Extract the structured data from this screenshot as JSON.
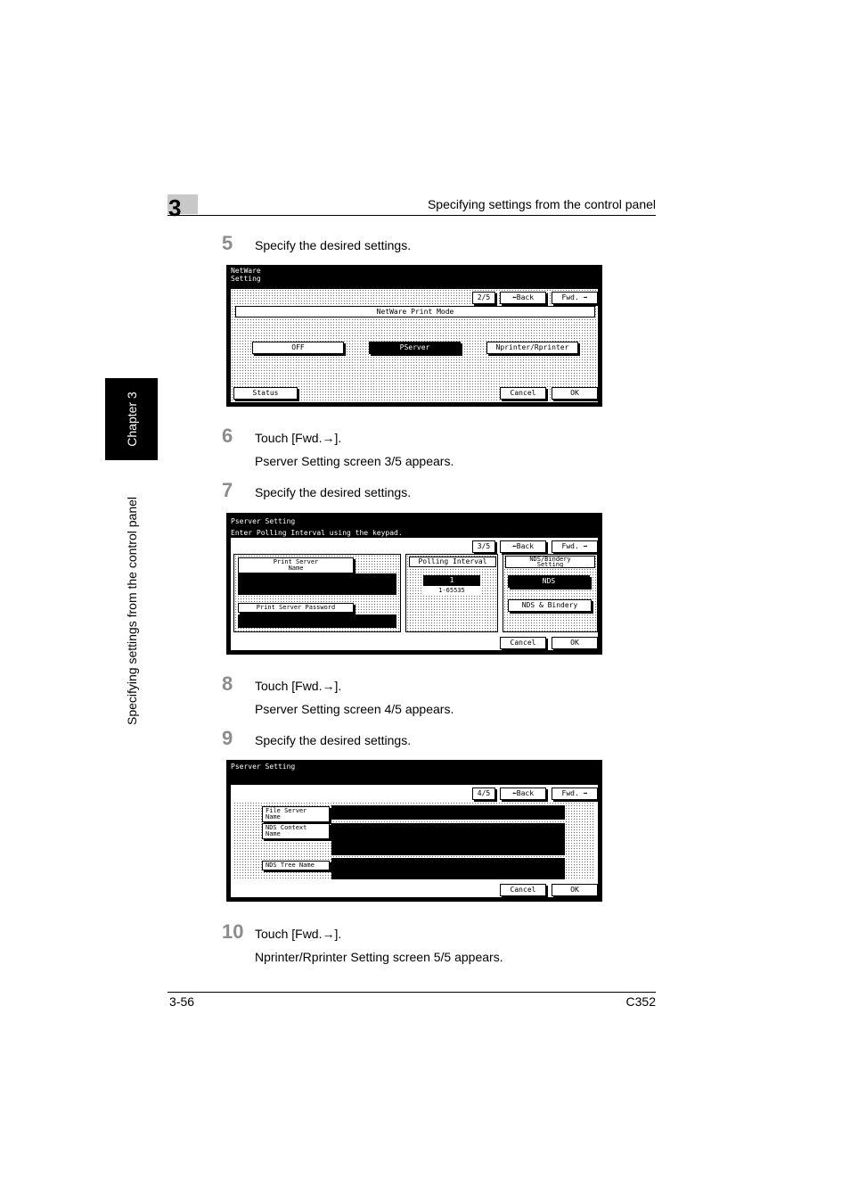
{
  "header": {
    "chapter_number": "3",
    "title": "Specifying settings from the control panel"
  },
  "side_tab": {
    "chapter_label": "Chapter 3",
    "section_label": "Specifying settings from the control panel"
  },
  "steps": [
    {
      "num": "5",
      "text": "Specify the desired settings."
    },
    {
      "num": "6",
      "text": "Touch [Fwd.→].",
      "sub": "Pserver Setting screen 3/5 appears."
    },
    {
      "num": "7",
      "text": "Specify the desired settings."
    },
    {
      "num": "8",
      "text": "Touch [Fwd.→].",
      "sub": "Pserver Setting screen 4/5 appears."
    },
    {
      "num": "9",
      "text": "Specify the desired settings."
    },
    {
      "num": "10",
      "text": "Touch [Fwd.→].",
      "sub": "Nprinter/Rprinter Setting screen 5/5 appears."
    }
  ],
  "screen1": {
    "title": "NetWare\nSetting",
    "page": "2/5",
    "back": "⬅Back",
    "fwd": "Fwd. ➡",
    "section_label": "NetWare Print Mode",
    "options": [
      "OFF",
      "PServer",
      "Nprinter/Rprinter"
    ],
    "selected": "PServer",
    "status": "Status",
    "cancel": "Cancel",
    "ok": "OK"
  },
  "screen2": {
    "title": "Pserver Setting",
    "subtitle": "Enter Polling Interval using the keypad.",
    "page": "3/5",
    "back": "⬅Back",
    "fwd": "Fwd. ➡",
    "print_server_name": "Print Server\nName",
    "print_server_password": "Print Server Password",
    "polling_label": "Polling Interval",
    "polling_value": "1",
    "polling_range": "1-65535",
    "nds_bindery_label": "NDS/Bindery\nSetting",
    "nds_options": [
      "NDS",
      "NDS & Bindery"
    ],
    "nds_selected": "NDS",
    "cancel": "Cancel",
    "ok": "OK"
  },
  "screen3": {
    "title": "Pserver Setting",
    "page": "4/5",
    "back": "⬅Back",
    "fwd": "Fwd. ➡",
    "file_server_name": "File Server\nName",
    "nds_context_name": "NDS Context\nName",
    "nds_tree_name": "NDS Tree Name",
    "cancel": "Cancel",
    "ok": "OK"
  },
  "footer": {
    "page": "3-56",
    "model": "C352"
  }
}
